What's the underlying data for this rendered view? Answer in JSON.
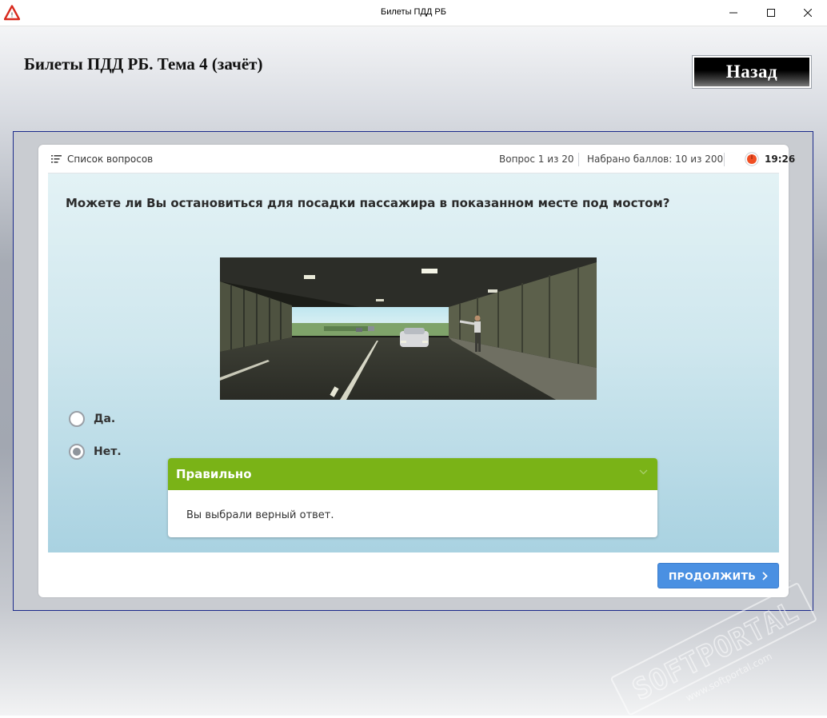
{
  "window": {
    "title": "Билеты ПДД РБ"
  },
  "header": {
    "title": "Билеты ПДД РБ. Тема 4 (зачёт)",
    "back_label": "Назад"
  },
  "toolbar": {
    "question_list_label": "Список вопросов",
    "question_counter": "Вопрос 1 из 20",
    "score": "Набрано баллов: 10 из 200",
    "timer": "19:26"
  },
  "question": {
    "text": "Можете ли Вы остановиться для посадки пассажира в показанном месте под мостом?",
    "answers": [
      {
        "label": "Да.",
        "selected": false
      },
      {
        "label": "Нет.",
        "selected": true
      }
    ]
  },
  "result": {
    "title": "Правильно",
    "message": "Вы выбрали верный ответ."
  },
  "footer": {
    "continue_label": "ПРОДОЛЖИТЬ"
  },
  "watermark": {
    "brand": "SOFTPORTAL",
    "url": "www.softportal.com",
    "tm": "TM"
  },
  "colors": {
    "correct_green": "#7ab317",
    "button_blue": "#4a90e2",
    "timer_red": "#f04e23",
    "frame_border": "#1b2a8a"
  }
}
